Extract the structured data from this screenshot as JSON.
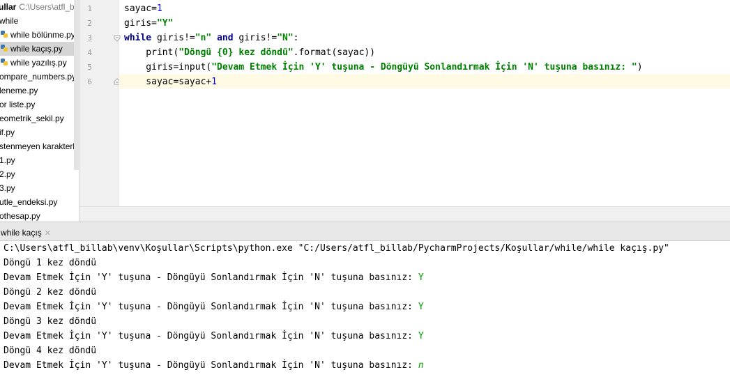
{
  "project": {
    "root_name": "ullar",
    "root_path": "C:\\Users\\atfl_bill",
    "items": [
      {
        "label": "while",
        "icon": "folder-icon"
      },
      {
        "label": "while bölünme.py",
        "icon": "python-file-icon"
      },
      {
        "label": "while kaçış.py",
        "icon": "python-file-icon",
        "selected": true
      },
      {
        "label": "while yazılış.py",
        "icon": "python-file-icon"
      },
      {
        "label": "ompare_numbers.py",
        "icon": "python-file-icon"
      },
      {
        "label": "leneme.py",
        "icon": "python-file-icon"
      },
      {
        "label": "or liste.py",
        "icon": "python-file-icon"
      },
      {
        "label": "eometrik_sekil.py",
        "icon": "python-file-icon"
      },
      {
        "label": "if.py",
        "icon": "python-file-icon"
      },
      {
        "label": "stenmeyen karakterler",
        "icon": "python-file-icon"
      },
      {
        "label": "1.py",
        "icon": "python-file-icon"
      },
      {
        "label": "2.py",
        "icon": "python-file-icon"
      },
      {
        "label": "3.py",
        "icon": "python-file-icon"
      },
      {
        "label": "utle_endeksi.py",
        "icon": "python-file-icon"
      },
      {
        "label": "othesap.py",
        "icon": "python-file-icon"
      }
    ]
  },
  "editor": {
    "line_numbers": [
      "1",
      "2",
      "3",
      "4",
      "5",
      "6"
    ],
    "code": {
      "l1": {
        "a": "sayac=",
        "b": "1"
      },
      "l2": {
        "a": "giris=",
        "b": "\"Y\""
      },
      "l3": {
        "kw1": "while",
        "a": " giris!=",
        "s1": "\"n\"",
        "kw2": "and",
        "b": " giris!=",
        "s2": "\"N\"",
        "c": ":"
      },
      "l4": {
        "a": "    print(",
        "s": "\"Döngü {0} kez döndü\"",
        "b": ".format(sayac))"
      },
      "l5": {
        "a": "    giris=input(",
        "s": "\"Devam Etmek İçin 'Y' tuşuna - Döngüyü Sonlandırmak İçin 'N' tuşuna basınız: \"",
        "b": ")"
      },
      "l6": {
        "a": "    sayac=sayac+",
        "b": "1"
      }
    }
  },
  "run": {
    "tab_label": "while kaçış",
    "console": [
      {
        "text": "C:\\Users\\atfl_billab\\venv\\Koşullar\\Scripts\\python.exe \"C:/Users/atfl_billab/PycharmProjects/Koşullar/while/while kaçış.py\"",
        "input": ""
      },
      {
        "text": "Döngü 1 kez döndü",
        "input": ""
      },
      {
        "text": "Devam Etmek İçin 'Y' tuşuna - Döngüyü Sonlandırmak İçin 'N' tuşuna basınız: ",
        "input": "Y"
      },
      {
        "text": "Döngü 2 kez döndü",
        "input": ""
      },
      {
        "text": "Devam Etmek İçin 'Y' tuşuna - Döngüyü Sonlandırmak İçin 'N' tuşuna basınız: ",
        "input": "Y"
      },
      {
        "text": "Döngü 3 kez döndü",
        "input": ""
      },
      {
        "text": "Devam Etmek İçin 'Y' tuşuna - Döngüyü Sonlandırmak İçin 'N' tuşuna basınız: ",
        "input": "Y"
      },
      {
        "text": "Döngü 4 kez döndü",
        "input": ""
      },
      {
        "text": "Devam Etmek İçin 'Y' tuşuna - Döngüyü Sonlandırmak İçin 'N' tuşuna basınız: ",
        "input": "n"
      }
    ]
  },
  "colors": {
    "keyword": "#000080",
    "string": "#008000",
    "number": "#0000ff",
    "console_input": "#00a000",
    "current_line": "#fffae3"
  }
}
